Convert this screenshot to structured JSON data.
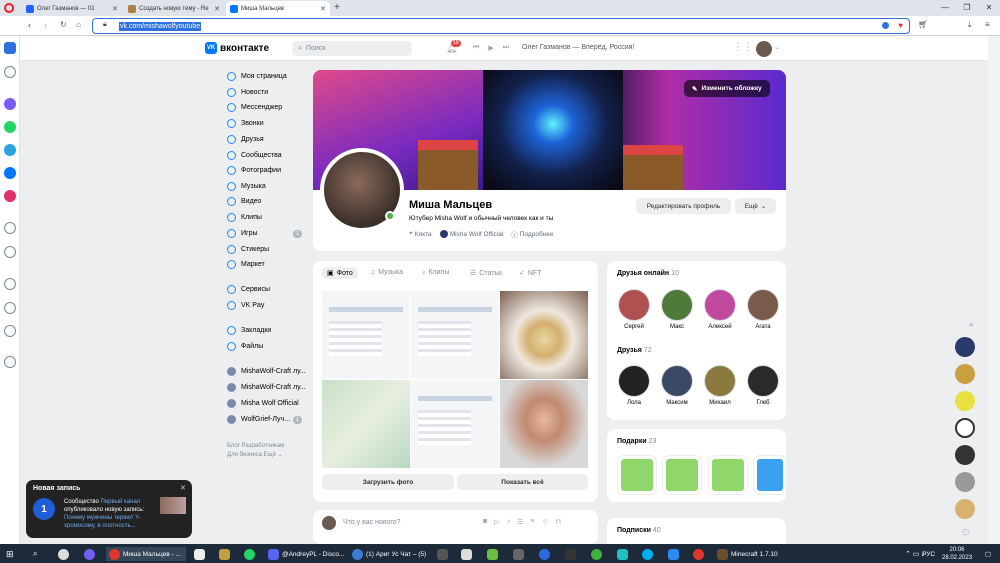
{
  "browser": {
    "tabs": [
      {
        "label": "Олег Газманов — 01",
        "color": "#1e63ff"
      },
      {
        "label": "Создать новую тему - Re",
        "color": "#b08040"
      },
      {
        "label": "Миша Мальцев",
        "color": "#0077ff"
      }
    ],
    "new_tab": "+",
    "url": "vk.com/mishawolfyoutube",
    "window_controls": [
      "—",
      "❐",
      "✕"
    ]
  },
  "vk": {
    "logo_text": "вконтакте",
    "search_placeholder": "Поиск",
    "notifications_count": "19",
    "now_playing": "Олег Газманов — Вперёд, Россия!",
    "accent": "#0077ff"
  },
  "nav": {
    "items": [
      {
        "label": "Моя страница"
      },
      {
        "label": "Новости"
      },
      {
        "label": "Мессенджер"
      },
      {
        "label": "Звонки"
      },
      {
        "label": "Друзья"
      },
      {
        "label": "Сообщества"
      },
      {
        "label": "Фотографии"
      },
      {
        "label": "Музыка"
      },
      {
        "label": "Видео"
      },
      {
        "label": "Клипы"
      },
      {
        "label": "Игры",
        "count": "1"
      },
      {
        "label": "Стикеры"
      },
      {
        "label": "Маркет"
      },
      {
        "label": "Сервисы"
      },
      {
        "label": "VK Pay"
      },
      {
        "label": "Закладки"
      },
      {
        "label": "Файлы"
      },
      {
        "label": "MishaWolf-Craft лу..."
      },
      {
        "label": "MishaWolf-Craft лу..."
      },
      {
        "label": "Misha Wolf Official"
      },
      {
        "label": "WolfGrief-Луч...",
        "count": "1"
      }
    ],
    "footer_line1": "Блог   Разработчикам",
    "footer_line2": "Для бизнеса   Ещё ⌄"
  },
  "profile": {
    "edit_cover": "Изменить обложку",
    "name": "Миша Мальцев",
    "status": "Ютубер Misha Wolf и обычный человек как и ты",
    "city": "Кяхта",
    "group": "Misha Wolf Official",
    "more_info": "Подробнее",
    "edit_profile": "Редактировать профиль",
    "more": "Ещё"
  },
  "photos": {
    "tabs": [
      "Фото",
      "Музыка",
      "Клипы",
      "Статьи",
      "NFT"
    ],
    "upload": "Загрузить фото",
    "show_all": "Показать всё"
  },
  "post": {
    "placeholder": "Что у вас нового?"
  },
  "friends_online": {
    "title": "Друзья онлайн",
    "count": "10",
    "people": [
      {
        "name": "Сергей",
        "color": "#b05050"
      },
      {
        "name": "Макс",
        "color": "#4f7a3a"
      },
      {
        "name": "Алексей",
        "color": "#c04aa0"
      },
      {
        "name": "Агата",
        "color": "#7a5a4a"
      }
    ]
  },
  "friends": {
    "title": "Друзья",
    "count": "72",
    "people": [
      {
        "name": "Лола",
        "color": "#222222"
      },
      {
        "name": "Максим",
        "color": "#3a4a66"
      },
      {
        "name": "Михаил",
        "color": "#8a7a40"
      },
      {
        "name": "Глеб",
        "color": "#2a2a2a"
      }
    ]
  },
  "gifts": {
    "title": "Подарки",
    "count": "23"
  },
  "subs": {
    "title": "Подписки",
    "count": "40"
  },
  "toast": {
    "title": "Новая запись",
    "prefix": "Сообщество ",
    "community": "Первый канал",
    "text": " опубликовало новую запись:",
    "headline": "Почему мужчины теряют Y-хромосому, в плотность..."
  },
  "taskbar": {
    "items": [
      {
        "label": "Миша Мальцев - ...",
        "color": "#e0362b"
      },
      {
        "label": "@AndreyPL - Disco...",
        "color": "#5865f2"
      },
      {
        "label": "(1) Ариг Ус Чат – (5)",
        "color": "#3a7bd5"
      },
      {
        "label": "Minecraft 1.7.10",
        "color": "#6b4e2e"
      }
    ],
    "lang": "РУС",
    "time": "20:06",
    "date": "28.02.2023"
  }
}
